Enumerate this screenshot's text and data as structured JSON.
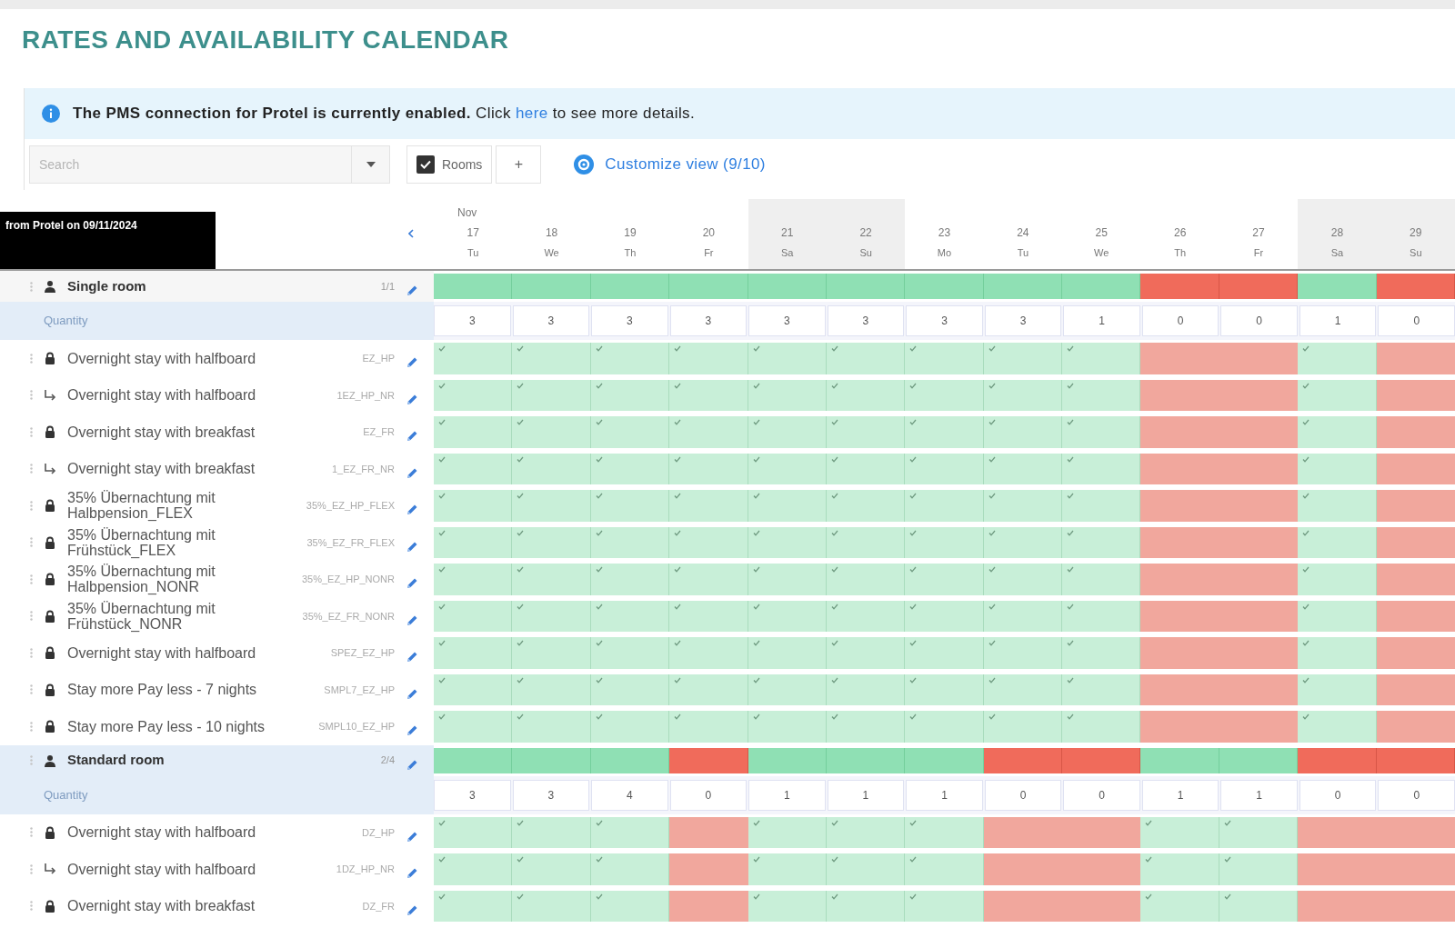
{
  "page_title": "RATES AND AVAILABILITY CALENDAR",
  "notice": {
    "message": "The PMS connection for Protel is currently enabled.",
    "before_link": "Click",
    "link": "here",
    "after_link": "to see more details."
  },
  "toolbar": {
    "search": {
      "placeholder": "Search"
    },
    "rooms_filter": {
      "label": "Rooms",
      "checked": true
    },
    "add_button": "+",
    "customize_link": "Customize view (9/10)"
  },
  "tooltip": "from Protel on 09/11/2024",
  "calendar": {
    "month": "Nov",
    "days": [
      {
        "date": "17",
        "weekday": "Tu",
        "weekend": false
      },
      {
        "date": "18",
        "weekday": "We",
        "weekend": false
      },
      {
        "date": "19",
        "weekday": "Th",
        "weekend": false
      },
      {
        "date": "20",
        "weekday": "Fr",
        "weekend": false
      },
      {
        "date": "21",
        "weekday": "Sa",
        "weekend": true
      },
      {
        "date": "22",
        "weekday": "Su",
        "weekend": true
      },
      {
        "date": "23",
        "weekday": "Mo",
        "weekend": false
      },
      {
        "date": "24",
        "weekday": "Tu",
        "weekend": false
      },
      {
        "date": "25",
        "weekday": "We",
        "weekend": false
      },
      {
        "date": "26",
        "weekday": "Th",
        "weekend": false
      },
      {
        "date": "27",
        "weekday": "Fr",
        "weekend": false
      },
      {
        "date": "28",
        "weekday": "Sa",
        "weekend": true
      },
      {
        "date": "29",
        "weekday": "Su",
        "weekend": true
      }
    ]
  },
  "room_groups": [
    {
      "name": "Single room",
      "code": "1/1",
      "highlighted": false,
      "quantity_label": "Quantity",
      "days": [
        {
          "quantity": "3",
          "open": true
        },
        {
          "quantity": "3",
          "open": true
        },
        {
          "quantity": "3",
          "open": true
        },
        {
          "quantity": "3",
          "open": true
        },
        {
          "quantity": "3",
          "open": true
        },
        {
          "quantity": "3",
          "open": true
        },
        {
          "quantity": "3",
          "open": true
        },
        {
          "quantity": "3",
          "open": true
        },
        {
          "quantity": "1",
          "open": true
        },
        {
          "quantity": "0",
          "open": false
        },
        {
          "quantity": "0",
          "open": false
        },
        {
          "quantity": "1",
          "open": true
        },
        {
          "quantity": "0",
          "open": false
        }
      ],
      "rates": [
        {
          "kind": "base",
          "name": "Overnight stay with halfboard",
          "code": "EZ_HP",
          "open": [
            true,
            true,
            true,
            true,
            true,
            true,
            true,
            true,
            true,
            false,
            false,
            true,
            false
          ]
        },
        {
          "kind": "derived",
          "name": "Overnight stay with halfboard",
          "code": "1EZ_HP_NR",
          "open": [
            true,
            true,
            true,
            true,
            true,
            true,
            true,
            true,
            true,
            false,
            false,
            true,
            false
          ]
        },
        {
          "kind": "base",
          "name": "Overnight stay with breakfast",
          "code": "EZ_FR",
          "open": [
            true,
            true,
            true,
            true,
            true,
            true,
            true,
            true,
            true,
            false,
            false,
            true,
            false
          ]
        },
        {
          "kind": "derived",
          "name": "Overnight stay with breakfast",
          "code": "1_EZ_FR_NR",
          "open": [
            true,
            true,
            true,
            true,
            true,
            true,
            true,
            true,
            true,
            false,
            false,
            true,
            false
          ]
        },
        {
          "kind": "base",
          "name": "35% Übernachtung mit Halbpension_FLEX",
          "code": "35%_EZ_HP_FLEX",
          "open": [
            true,
            true,
            true,
            true,
            true,
            true,
            true,
            true,
            true,
            false,
            false,
            true,
            false
          ]
        },
        {
          "kind": "base",
          "name": "35% Übernachtung mit Frühstück_FLEX",
          "code": "35%_EZ_FR_FLEX",
          "open": [
            true,
            true,
            true,
            true,
            true,
            true,
            true,
            true,
            true,
            false,
            false,
            true,
            false
          ]
        },
        {
          "kind": "base",
          "name": "35% Übernachtung mit Halbpension_NONR",
          "code": "35%_EZ_HP_NONR",
          "open": [
            true,
            true,
            true,
            true,
            true,
            true,
            true,
            true,
            true,
            false,
            false,
            true,
            false
          ]
        },
        {
          "kind": "base",
          "name": "35% Übernachtung mit Frühstück_NONR",
          "code": "35%_EZ_FR_NONR",
          "open": [
            true,
            true,
            true,
            true,
            true,
            true,
            true,
            true,
            true,
            false,
            false,
            true,
            false
          ]
        },
        {
          "kind": "base",
          "name": "Overnight stay with halfboard",
          "code": "SPEZ_EZ_HP",
          "open": [
            true,
            true,
            true,
            true,
            true,
            true,
            true,
            true,
            true,
            false,
            false,
            true,
            false
          ]
        },
        {
          "kind": "base",
          "name": "Stay more Pay less - 7 nights",
          "code": "SMPL7_EZ_HP",
          "open": [
            true,
            true,
            true,
            true,
            true,
            true,
            true,
            true,
            true,
            false,
            false,
            true,
            false
          ]
        },
        {
          "kind": "base",
          "name": "Stay more Pay less - 10 nights",
          "code": "SMPL10_EZ_HP",
          "open": [
            true,
            true,
            true,
            true,
            true,
            true,
            true,
            true,
            true,
            false,
            false,
            true,
            false
          ]
        }
      ]
    },
    {
      "name": "Standard room",
      "code": "2/4",
      "highlighted": true,
      "quantity_label": "Quantity",
      "days": [
        {
          "quantity": "3",
          "open": true
        },
        {
          "quantity": "3",
          "open": true
        },
        {
          "quantity": "4",
          "open": true
        },
        {
          "quantity": "0",
          "open": false
        },
        {
          "quantity": "1",
          "open": true
        },
        {
          "quantity": "1",
          "open": true
        },
        {
          "quantity": "1",
          "open": true
        },
        {
          "quantity": "0",
          "open": false
        },
        {
          "quantity": "0",
          "open": false
        },
        {
          "quantity": "1",
          "open": true
        },
        {
          "quantity": "1",
          "open": true
        },
        {
          "quantity": "0",
          "open": false
        },
        {
          "quantity": "0",
          "open": false
        }
      ],
      "rates": [
        {
          "kind": "base",
          "name": "Overnight stay with halfboard",
          "code": "DZ_HP",
          "open": [
            true,
            true,
            true,
            false,
            true,
            true,
            true,
            false,
            false,
            true,
            true,
            false,
            false
          ]
        },
        {
          "kind": "derived",
          "name": "Overnight stay with halfboard",
          "code": "1DZ_HP_NR",
          "open": [
            true,
            true,
            true,
            false,
            true,
            true,
            true,
            false,
            false,
            true,
            true,
            false,
            false
          ]
        },
        {
          "kind": "base",
          "name": "Overnight stay with breakfast",
          "code": "DZ_FR",
          "open": [
            true,
            true,
            true,
            false,
            true,
            true,
            true,
            false,
            false,
            true,
            true,
            false,
            false
          ]
        }
      ]
    }
  ]
}
